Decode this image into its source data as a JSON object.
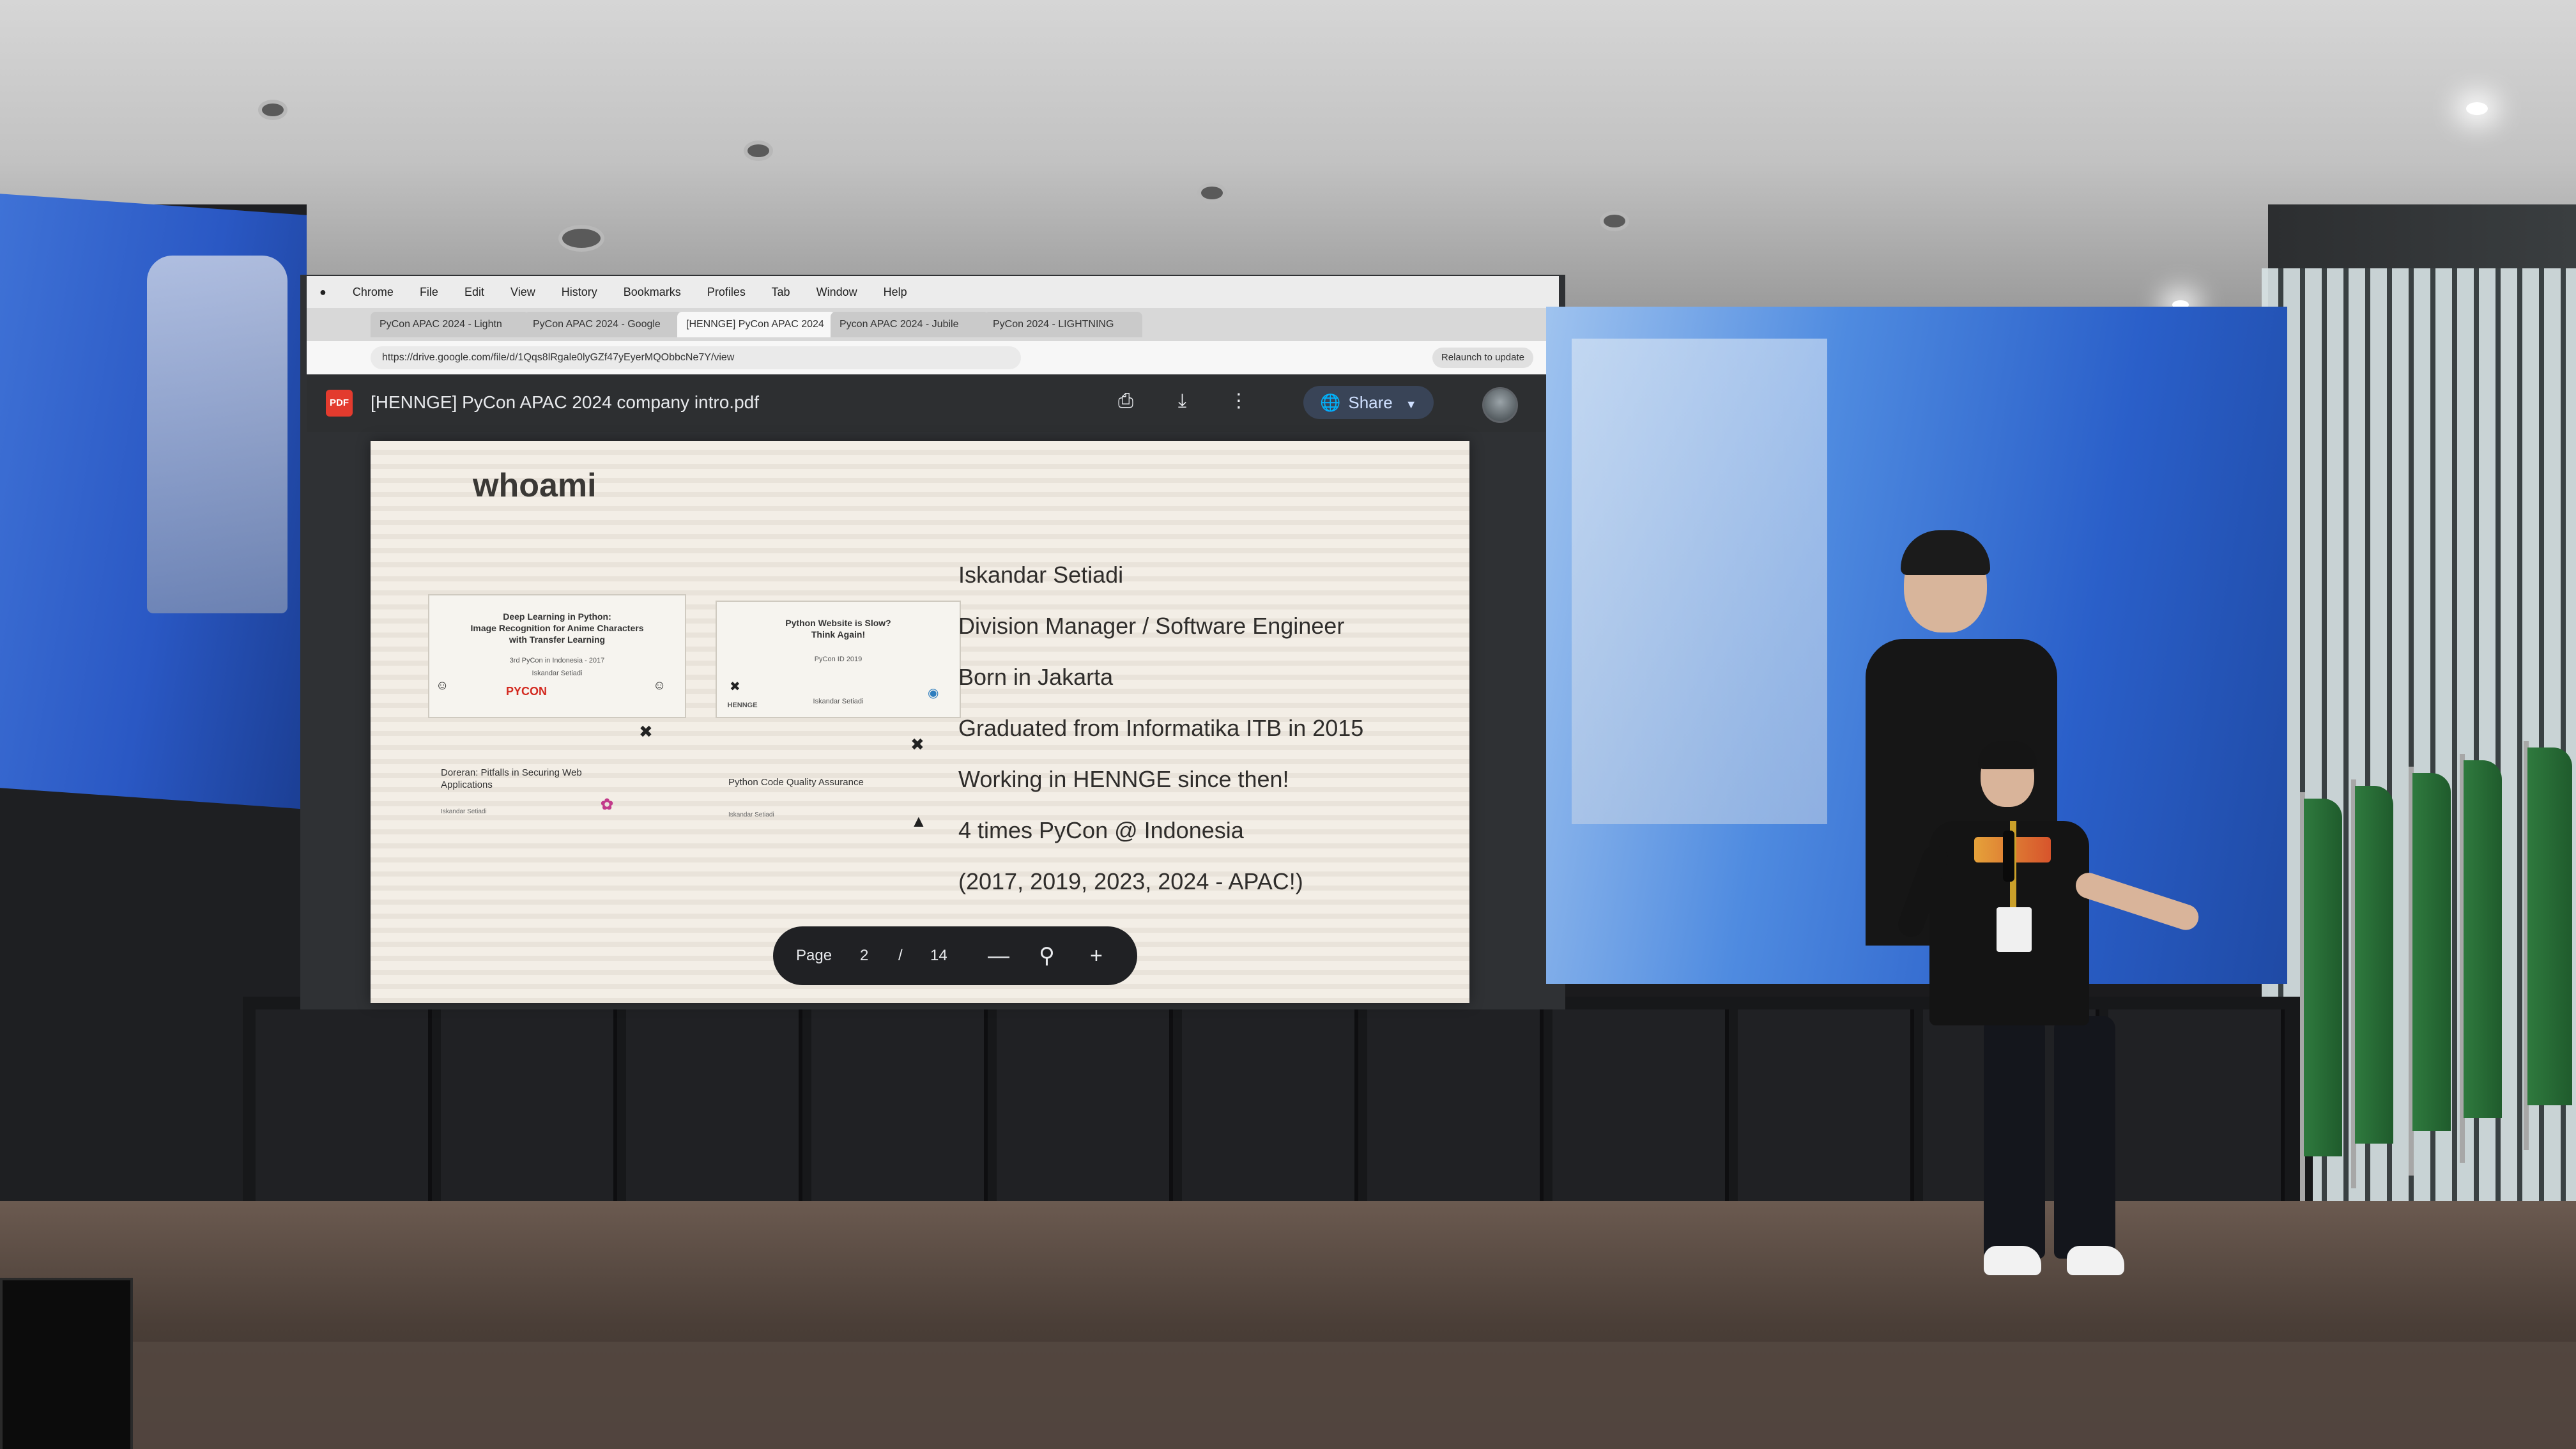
{
  "browser": {
    "menu_bar": [
      "Chrome",
      "File",
      "Edit",
      "View",
      "History",
      "Bookmarks",
      "Profiles",
      "Tab",
      "Window",
      "Help"
    ],
    "tabs": [
      {
        "label": "PyCon APAC 2024 - Lightn"
      },
      {
        "label": "PyCon APAC 2024 - Google"
      },
      {
        "label": "[HENNGE] PyCon APAC 2024"
      },
      {
        "label": "Pycon APAC 2024 - Jubile"
      },
      {
        "label": "PyCon 2024 - LIGHTNING"
      }
    ],
    "url": "https://drive.google.com/file/d/1Qqs8lRgale0lyGZf47yEyerMQObbcNe7Y/view",
    "relaunch_label": "Relaunch to update"
  },
  "pdf_viewer": {
    "badge": "PDF",
    "document_title": "[HENNGE] PyCon APAC 2024 company intro.pdf",
    "share_label": "Share",
    "icons": [
      "print-icon",
      "download-icon",
      "more-vert-icon",
      "globe-icon",
      "chevron-down-icon",
      "avatar"
    ],
    "page_label": "Page",
    "current_page": "2",
    "separator": "/",
    "total_pages": "14"
  },
  "slide": {
    "title": "whoami",
    "lines": [
      "Iskandar Setiadi",
      "Division Manager / Software Engineer",
      "Born in Jakarta",
      "Graduated from Informatika ITB in 2015",
      "Working in HENNGE since then!",
      "4 times PyCon @ Indonesia",
      "(2017, 2019, 2023, 2024 - APAC!)"
    ],
    "thumbnails": [
      {
        "title": "Deep Learning in Python:\nImage Recognition for Anime Characters\nwith Transfer Learning",
        "event": "3rd PyCon in Indonesia - 2017",
        "author": "Iskandar Setiadi",
        "brand": "PYCON"
      },
      {
        "title": "Python Website is Slow?\nThink Again!",
        "event": "PyCon ID 2019",
        "author": "Iskandar Setiadi",
        "brand": "HENNGE"
      }
    ],
    "talks": [
      {
        "title": "Doreran: Pitfalls in Securing Web Applications",
        "author": "Iskandar Setiadi"
      },
      {
        "title": "Python Code Quality Assurance",
        "author": "Iskandar Setiadi"
      }
    ]
  }
}
